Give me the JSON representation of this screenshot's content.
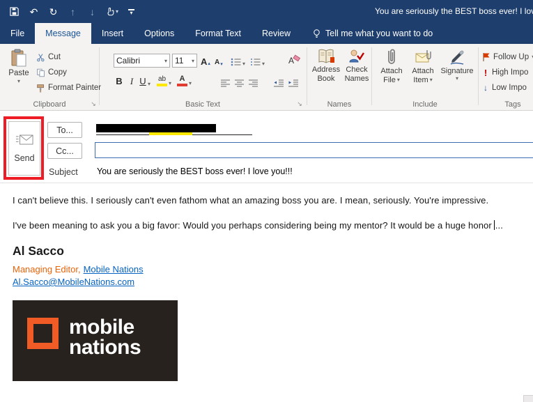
{
  "titlebar": {
    "title": "You are seriously the BEST boss ever! I love y"
  },
  "tabs": [
    {
      "label": "File"
    },
    {
      "label": "Message"
    },
    {
      "label": "Insert"
    },
    {
      "label": "Options"
    },
    {
      "label": "Format Text"
    },
    {
      "label": "Review"
    }
  ],
  "tell_me": "Tell me what you want to do",
  "ribbon": {
    "clipboard": {
      "group_label": "Clipboard",
      "paste_label": "Paste",
      "cut_label": "Cut",
      "copy_label": "Copy",
      "format_painter_label": "Format Painter"
    },
    "basic_text": {
      "group_label": "Basic Text",
      "font_name": "Calibri",
      "font_size": "11",
      "bold_label": "B",
      "italic_label": "I",
      "underline_label": "U",
      "highlight_label": "ab",
      "font_color_label": "A",
      "clear_format_label": "A"
    },
    "names": {
      "group_label": "Names",
      "address_book_line1": "Address",
      "address_book_line2": "Book",
      "check_names_line1": "Check",
      "check_names_line2": "Names"
    },
    "include": {
      "group_label": "Include",
      "attach_file_line1": "Attach",
      "attach_file_line2": "File",
      "attach_item_line1": "Attach",
      "attach_item_line2": "Item",
      "signature_label": "Signature"
    },
    "tags": {
      "group_label": "Tags",
      "follow_up_label": "Follow Up",
      "high_importance_label": "High Impo",
      "low_importance_label": "Low Impo"
    }
  },
  "compose": {
    "send_label": "Send",
    "to_label": "To...",
    "cc_label": "Cc...",
    "subject_label": "Subject",
    "subject_value": "You are seriously the BEST boss ever! I love you!!!"
  },
  "message": {
    "paragraph1": "I can't believe this. I seriously can't even fathom what an amazing boss you are. I mean, seriously. You're impressive.",
    "paragraph2": "I've been meaning to ask you a big favor: Would you perhaps considering being my mentor? It would be a huge honor",
    "paragraph2_trailing": "...",
    "signature_name": "Al Sacco",
    "signature_title": "Managing Editor,",
    "signature_org": "Mobile Nations",
    "signature_email": "Al.Sacco@MobileNations.com"
  },
  "logo": {
    "line1": "mobile",
    "line2": "nations"
  },
  "colors": {
    "titlebar_blue": "#1e3e6d",
    "ribbon_bg": "#f4f3f1",
    "active_tab_text": "#1a5496",
    "annotation_red": "#ee1c25",
    "link_blue": "#0563c1",
    "signature_orange": "#e8630a",
    "logo_orange": "#f15b25",
    "logo_bg": "#27221e",
    "highlight_yellow": "#ffe800"
  }
}
